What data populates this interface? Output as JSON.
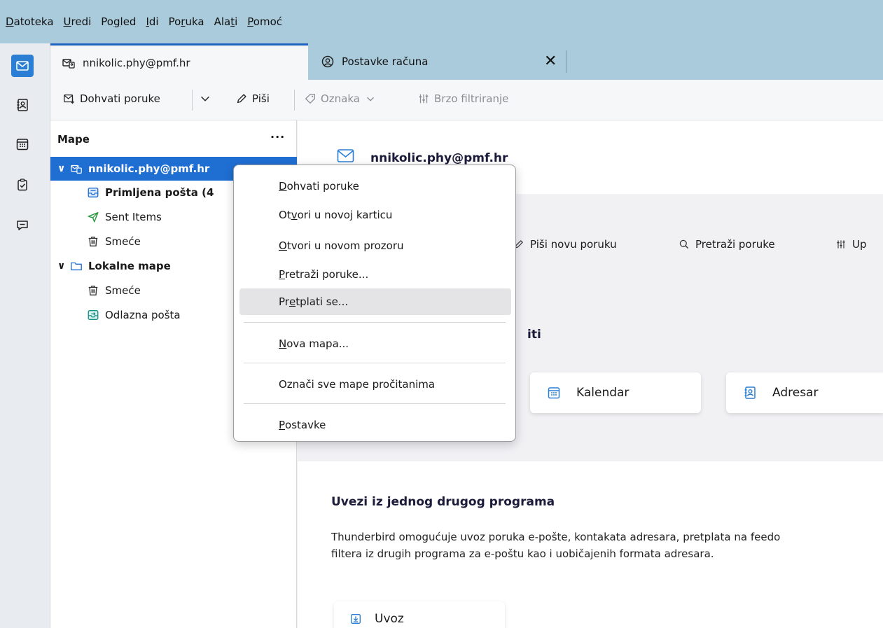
{
  "menubar": {
    "items": [
      {
        "pre": "",
        "acc": "D",
        "post": "atoteka"
      },
      {
        "pre": "",
        "acc": "U",
        "post": "redi"
      },
      {
        "pre": "Po",
        "acc": "g",
        "post": "led"
      },
      {
        "pre": "",
        "acc": "I",
        "post": "di"
      },
      {
        "pre": "Po",
        "acc": "r",
        "post": "uka"
      },
      {
        "pre": "Ala",
        "acc": "t",
        "post": "i"
      },
      {
        "pre": "",
        "acc": "P",
        "post": "omoć"
      }
    ]
  },
  "tabs": {
    "active": "nnikolic.phy@pmf.hr",
    "second": "Postavke računa",
    "close": "✕"
  },
  "toolbar": {
    "get_messages": "Dohvati poruke",
    "write": "Piši",
    "tag": "Oznaka",
    "quick_filter": "Brzo filtriranje"
  },
  "folders": {
    "header": "Mape",
    "more": "···",
    "account": "nnikolic.phy@pmf.hr",
    "inbox": "Primljena pošta (4",
    "sent": "Sent Items",
    "trash": "Smeće",
    "local": "Lokalne mape",
    "local_trash": "Smeće",
    "outbox": "Odlazna pošta"
  },
  "main": {
    "account_title": "nnikolic.phy@pmf.hr",
    "write_new": "Piši novu poruku",
    "search": "Pretraži poruke",
    "filters": "Up",
    "setup_heading": "iti",
    "calendar": "Kalendar",
    "addressbook": "Adresar",
    "import_heading": "Uvezi iz jednog drugog programa",
    "import_desc_1": "Thunderbird omogućuje uvoz poruka e-pošte, kontakata adresara, pretplata na feedo",
    "import_desc_2": "filtera iz drugih programa za e-poštu kao i uobičajenih formata adresara.",
    "import_button": "Uvoz"
  },
  "context_menu": {
    "items": [
      {
        "pre": "",
        "acc": "D",
        "post": "ohvati poruke"
      },
      {
        "pre": "Ot",
        "acc": "v",
        "post": "ori u novoj karticu"
      },
      {
        "pre": "",
        "acc": "O",
        "post": "tvori u novom prozoru"
      },
      {
        "pre": "",
        "acc": "P",
        "post": "retraži poruke..."
      },
      {
        "pre": "Pr",
        "acc": "e",
        "post": "tplati se..."
      },
      {
        "pre": "",
        "acc": "N",
        "post": "ova mapa..."
      },
      {
        "pre": "",
        "acc": "",
        "post": "Označi sve mape pročitanima"
      },
      {
        "pre": "",
        "acc": "P",
        "post": "ostavke"
      }
    ],
    "highlighted_index": 4
  },
  "colors": {
    "accent": "#1f6ed2",
    "menubar": "#a9cbdc"
  }
}
